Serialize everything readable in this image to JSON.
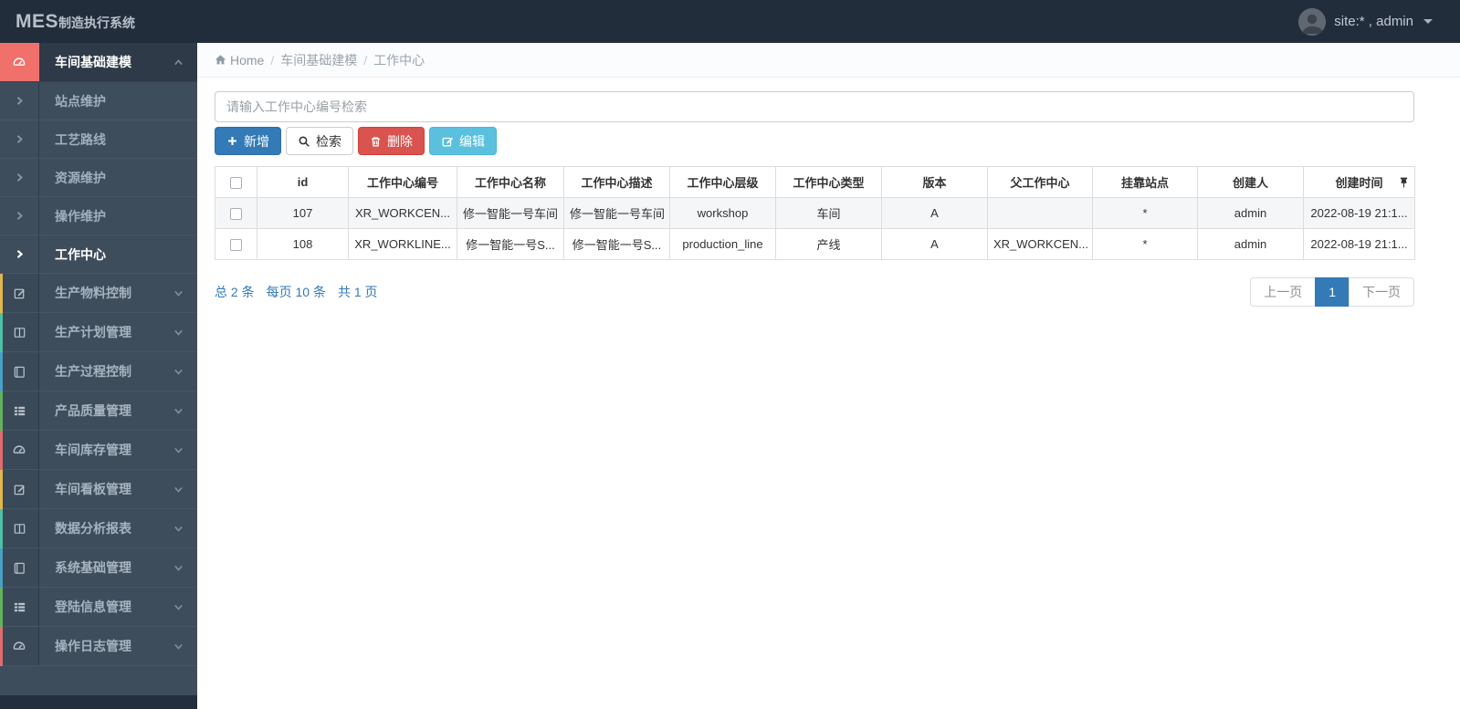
{
  "topbar": {
    "brand_mes": "MES",
    "brand_suffix": "制造执行系统",
    "user_label": "site:* , admin"
  },
  "breadcrumb": {
    "home": "Home",
    "items": [
      "车间基础建模",
      "工作中心"
    ]
  },
  "sidebar": {
    "group_label": "车间基础建模",
    "sub_items": [
      {
        "label": "站点维护"
      },
      {
        "label": "工艺路线"
      },
      {
        "label": "资源维护"
      },
      {
        "label": "操作维护"
      },
      {
        "label": "工作中心"
      }
    ],
    "category_items": [
      {
        "label": "生产物料控制",
        "border": "#e0b64e"
      },
      {
        "label": "生产计划管理",
        "border": "#4fbfa6"
      },
      {
        "label": "生产过程控制",
        "border": "#4a9fc6"
      },
      {
        "label": "产品质量管理",
        "border": "#63b05e"
      },
      {
        "label": "车间库存管理",
        "border": "#e26b6f"
      },
      {
        "label": "车间看板管理",
        "border": "#e0b64e"
      },
      {
        "label": "数据分析报表",
        "border": "#4fbfa6"
      },
      {
        "label": "系统基础管理",
        "border": "#4a9fc6"
      },
      {
        "label": "登陆信息管理",
        "border": "#63b05e"
      },
      {
        "label": "操作日志管理",
        "border": "#e26b6f"
      }
    ]
  },
  "toolbar": {
    "search_placeholder": "请输入工作中心编号检索",
    "add_label": "新增",
    "search_label": "检索",
    "delete_label": "删除",
    "edit_label": "编辑"
  },
  "table": {
    "headers": [
      "id",
      "工作中心编号",
      "工作中心名称",
      "工作中心描述",
      "工作中心层级",
      "工作中心类型",
      "版本",
      "父工作中心",
      "挂靠站点",
      "创建人",
      "创建时间"
    ],
    "rows": [
      [
        "107",
        "XR_WORKCEN...",
        "修一智能一号车间",
        "修一智能一号车间",
        "workshop",
        "车间",
        "A",
        "",
        "*",
        "admin",
        "2022-08-19 21:1..."
      ],
      [
        "108",
        "XR_WORKLINE...",
        "修一智能一号S...",
        "修一智能一号S...",
        "production_line",
        "产线",
        "A",
        "XR_WORKCEN...",
        "*",
        "admin",
        "2022-08-19 21:1..."
      ]
    ]
  },
  "pagination": {
    "total": "总 2 条",
    "per_page": "每页 10 条",
    "pages": "共 1 页",
    "prev_label": "上一页",
    "current_page": "1",
    "next_label": "下一页"
  },
  "colors": {
    "topbar_bg": "#222d3c",
    "sidebar_bg": "#3e4d5c",
    "active_group_bg": "#2e3a48",
    "active_icon_bg": "#f0716b",
    "primary": "#337ab7",
    "danger": "#d9534f",
    "info": "#5bc0de",
    "link": "#337ab7"
  }
}
